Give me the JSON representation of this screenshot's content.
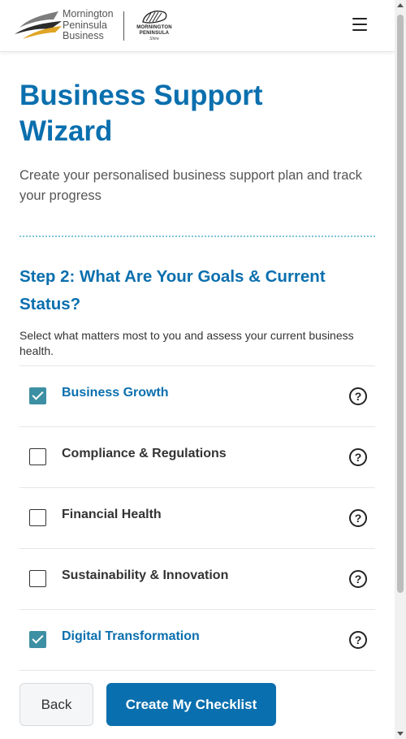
{
  "header": {
    "logo_text": [
      "Mornington",
      "Peninsula",
      "Business"
    ],
    "shire_logo": {
      "line1": "MORNINGTON",
      "line2": "PENINSULA",
      "line3": "Shire"
    }
  },
  "page": {
    "title_line1": "Business Support",
    "title_line2": "Wizard",
    "subtitle": "Create your personalised business support plan and track your progress"
  },
  "step": {
    "title": "Step 2: What Are Your Goals & Current Status?",
    "description": "Select what matters most to you and assess your current business health."
  },
  "goals": [
    {
      "label": "Business Growth",
      "checked": true
    },
    {
      "label": "Compliance & Regulations",
      "checked": false
    },
    {
      "label": "Financial Health",
      "checked": false
    },
    {
      "label": "Sustainability & Innovation",
      "checked": false
    },
    {
      "label": "Digital Transformation",
      "checked": true
    }
  ],
  "help_glyph": "?",
  "footer": {
    "back_label": "Back",
    "create_label": "Create My Checklist"
  },
  "colors": {
    "primary": "#0a6fae",
    "checkbox_checked": "#3d8fa3",
    "divider": "#7fc3d8"
  }
}
